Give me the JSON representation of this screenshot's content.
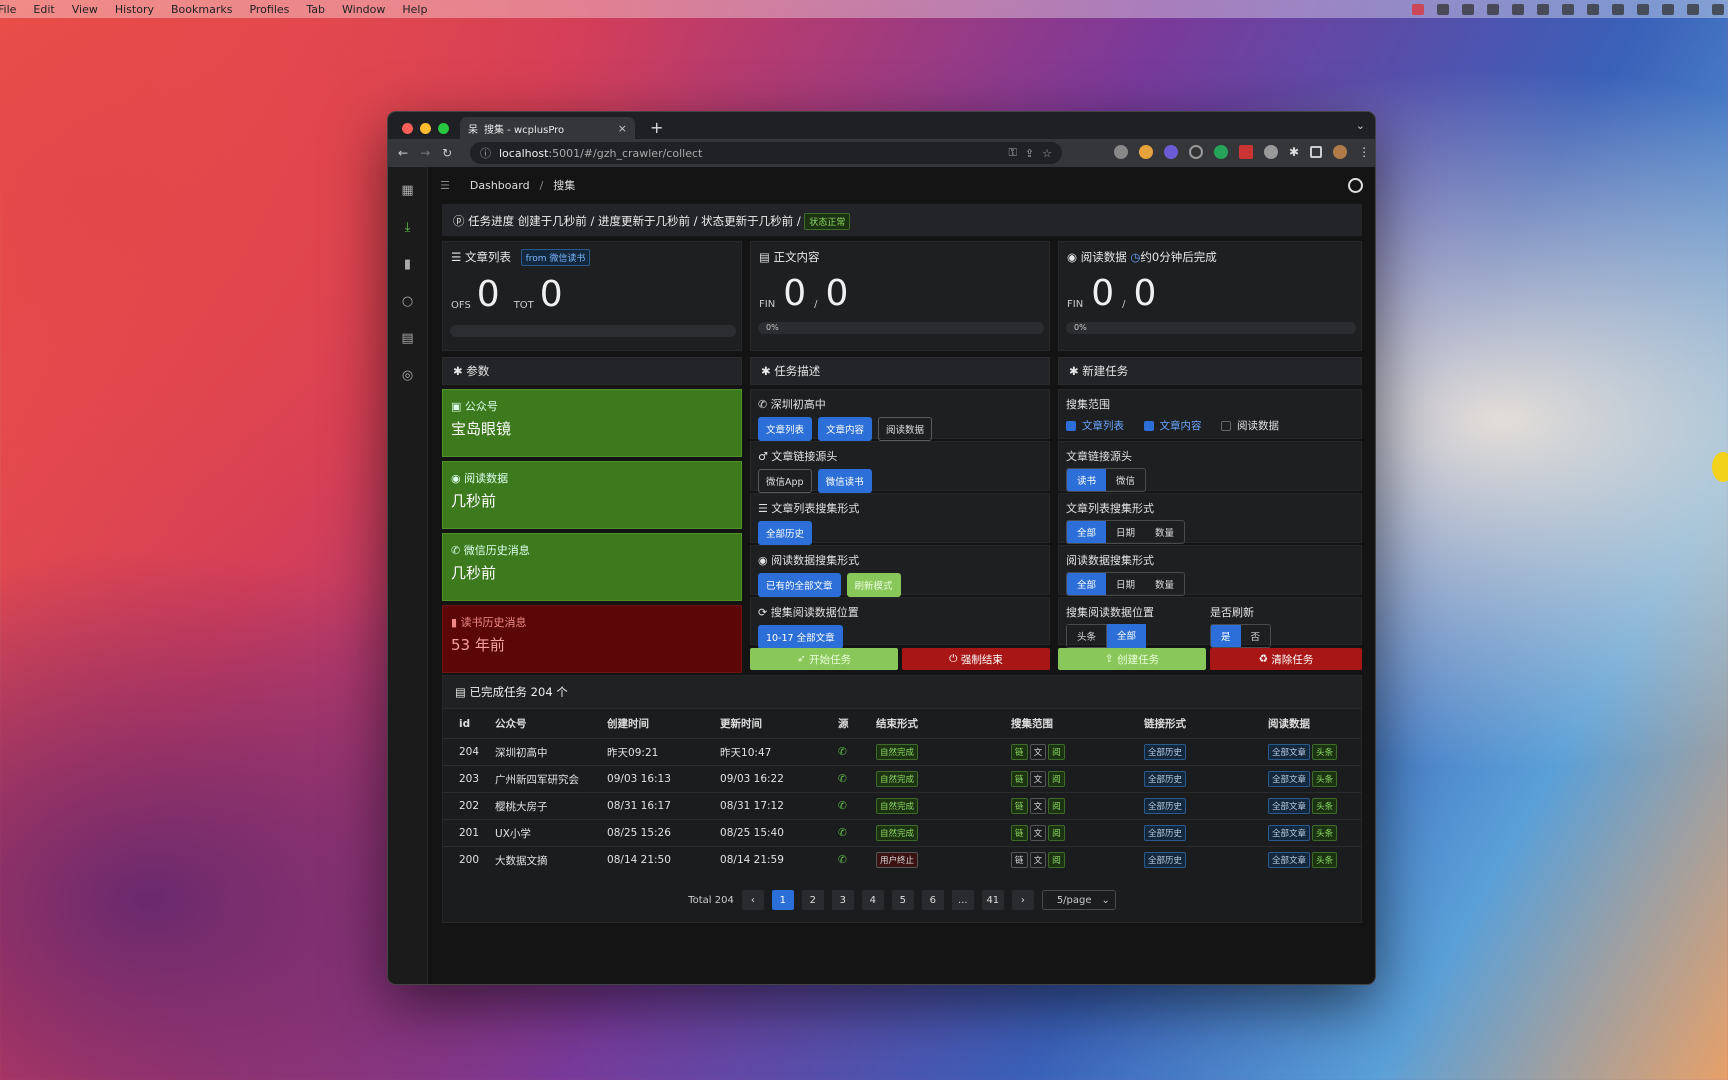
{
  "os_menu": {
    "items": [
      "File",
      "Edit",
      "View",
      "History",
      "Bookmarks",
      "Profiles",
      "Tab",
      "Window",
      "Help"
    ]
  },
  "browser": {
    "tab_title": "搜集 - wcplusPro",
    "url_host": "localhost",
    "url_rest": ":5001/#/gzh_crawler/collect",
    "tab_close": "×",
    "new_tab": "+",
    "tab_menu": "⌄"
  },
  "breadcrumb": {
    "root": "Dashboard",
    "sep": "/",
    "current": "搜集"
  },
  "progress": {
    "title": "任务进度 创建于几秒前 / 进度更新于几秒前 / 状态更新于几秒前 /",
    "status": "状态正常"
  },
  "stats": {
    "list": {
      "title": "文章列表",
      "source_tag": "from 微信读书",
      "ofs_label": "OFS",
      "ofs": "0",
      "tot_label": "TOT",
      "tot": "0",
      "progress_pct": 0
    },
    "content": {
      "title": "正文内容",
      "fin_label": "FIN",
      "fin": "0",
      "slash": "/",
      "total": "0",
      "pct": "0%"
    },
    "read": {
      "title": "阅读数据",
      "eta": "约0分钟后完成",
      "fin_label": "FIN",
      "fin": "0",
      "slash": "/",
      "total": "0",
      "pct": "0%"
    }
  },
  "params": {
    "title": "参数",
    "cards": [
      {
        "label": "公众号",
        "value": "宝岛眼镜"
      },
      {
        "label": "阅读数据",
        "value": "几秒前"
      },
      {
        "label": "微信历史消息",
        "value": "几秒前"
      },
      {
        "label": "读书历史消息",
        "value": "53 年前"
      }
    ]
  },
  "task_desc": {
    "title": "任务描述",
    "name": "深圳初高中",
    "name_btns": [
      "文章列表",
      "文章内容",
      "阅读数据"
    ],
    "src_label": "文章链接源头",
    "src_btns": [
      "微信App",
      "微信读书"
    ],
    "list_label": "文章列表搜集形式",
    "list_btns": [
      "全部历史"
    ],
    "read_label": "阅读数据搜集形式",
    "read_btns": [
      "已有的全部文章",
      "刷新模式"
    ],
    "pos_label": "搜集阅读数据位置",
    "pos_btns": [
      "10-17 全部文章"
    ],
    "start": "开始任务",
    "stop": "强制结束"
  },
  "new_task": {
    "title": "新建任务",
    "scope_label": "搜集范围",
    "scope": [
      "文章列表",
      "文章内容",
      "阅读数据"
    ],
    "src_label": "文章链接源头",
    "src": [
      "读书",
      "微信"
    ],
    "list_label": "文章列表搜集形式",
    "list": [
      "全部",
      "日期",
      "数量"
    ],
    "read_label": "阅读数据搜集形式",
    "read": [
      "全部",
      "日期",
      "数量"
    ],
    "pos_label": "搜集阅读数据位置",
    "pos": [
      "头条",
      "全部"
    ],
    "refresh_label": "是否刷新",
    "refresh": [
      "是",
      "否"
    ],
    "create": "创建任务",
    "clear": "清除任务"
  },
  "done": {
    "title": "已完成任务 204 个",
    "cols": [
      "id",
      "公众号",
      "创建时间",
      "更新时间",
      "源",
      "结束形式",
      "搜集范围",
      "链接形式",
      "阅读数据"
    ],
    "rows": [
      {
        "id": "204",
        "name": "深圳初高中",
        "created": "昨天09:21",
        "updated": "昨天10:47",
        "end": "自然完成",
        "link": "全部历史",
        "r1": "全部文章",
        "r2": "头条"
      },
      {
        "id": "203",
        "name": "广州新四军研究会",
        "created": "09/03 16:13",
        "updated": "09/03 16:22",
        "end": "自然完成",
        "link": "全部历史",
        "r1": "全部文章",
        "r2": "头条"
      },
      {
        "id": "202",
        "name": "樱桃大房子",
        "created": "08/31 16:17",
        "updated": "08/31 17:12",
        "end": "自然完成",
        "link": "全部历史",
        "r1": "全部文章",
        "r2": "头条"
      },
      {
        "id": "201",
        "name": "UX小学",
        "created": "08/25 15:26",
        "updated": "08/25 15:40",
        "end": "自然完成",
        "link": "全部历史",
        "r1": "全部文章",
        "r2": "头条"
      },
      {
        "id": "200",
        "name": "大数据文摘",
        "created": "08/14 21:50",
        "updated": "08/14 21:59",
        "end": "用户终止",
        "link": "全部历史",
        "r1": "全部文章",
        "r2": "头条"
      }
    ],
    "scope_tags": [
      "链",
      "文",
      "阅"
    ],
    "pager": {
      "total": "Total 204",
      "pages": [
        "1",
        "2",
        "3",
        "4",
        "5",
        "6",
        "...",
        "41"
      ],
      "prev": "‹",
      "next": "›",
      "per": "5/page"
    }
  }
}
